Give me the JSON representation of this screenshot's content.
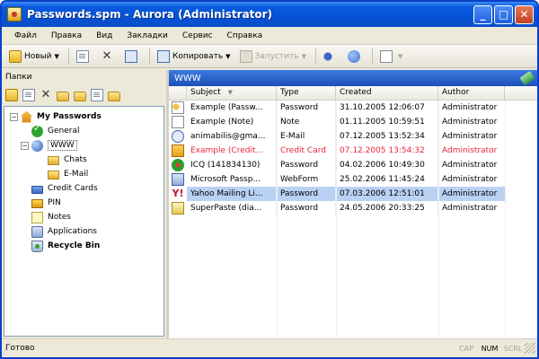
{
  "window": {
    "title": "Passwords.spm - Aurora (Administrator)"
  },
  "menu": [
    "Файл",
    "Правка",
    "Вид",
    "Закладки",
    "Сервис",
    "Справка"
  ],
  "toolbar": {
    "new_label": "Новый",
    "copy_label": "Копировать",
    "run_label": "Запустить"
  },
  "left_pane": {
    "label": "Папки",
    "tree": [
      {
        "label": "My Passwords",
        "bold": true
      },
      {
        "label": "General"
      },
      {
        "label": "WWW"
      },
      {
        "label": "Chats"
      },
      {
        "label": "E-Mail"
      },
      {
        "label": "Credit Cards"
      },
      {
        "label": "PIN"
      },
      {
        "label": "Notes"
      },
      {
        "label": "Applications"
      },
      {
        "label": "Recycle Bin",
        "bold": true
      }
    ]
  },
  "right_pane": {
    "folder_title": "WWW",
    "columns": [
      "Subject",
      "Type",
      "Created",
      "Author"
    ],
    "rows": [
      {
        "subject": "Example (Passw...",
        "type": "Password",
        "created": "31.10.2005 12:06:07",
        "author": "Administrator",
        "icon": "key"
      },
      {
        "subject": "Example (Note)",
        "type": "Note",
        "created": "01.11.2005 10:59:51",
        "author": "Administrator",
        "icon": "note"
      },
      {
        "subject": "animabilis@gma...",
        "type": "E-Mail",
        "created": "07.12.2005 13:52:34",
        "author": "Administrator",
        "icon": "mail"
      },
      {
        "subject": "Example (Credit...",
        "type": "Credit Card",
        "created": "07.12.2005 13:54:32",
        "author": "Administrator",
        "icon": "card",
        "highlight": "red"
      },
      {
        "subject": "ICQ (141834130)",
        "type": "Password",
        "created": "04.02.2006 10:49:30",
        "author": "Administrator",
        "icon": "icq"
      },
      {
        "subject": "Microsoft Passp...",
        "type": "WebForm",
        "created": "25.02.2006 11:45:24",
        "author": "Administrator",
        "icon": "web"
      },
      {
        "subject": "Yahoo Mailing Li...",
        "type": "Password",
        "created": "07.03.2006 12:51:01",
        "author": "Administrator",
        "icon": "yahoo",
        "selected": true
      },
      {
        "subject": "SuperPaste (dia...",
        "type": "Password",
        "created": "24.05.2006 20:33:25",
        "author": "Administrator",
        "icon": "superpaste"
      }
    ]
  },
  "status": {
    "text": "Готово",
    "indicators": [
      {
        "label": "CAP",
        "on": false
      },
      {
        "label": "NUM",
        "on": true
      },
      {
        "label": "SCRL",
        "on": false
      }
    ]
  },
  "colors": {
    "title_bar": "#0552d6",
    "folder_header": "#2b62c9",
    "selected_row": "#b9d1f3",
    "red_row_text": "#e8263a"
  }
}
